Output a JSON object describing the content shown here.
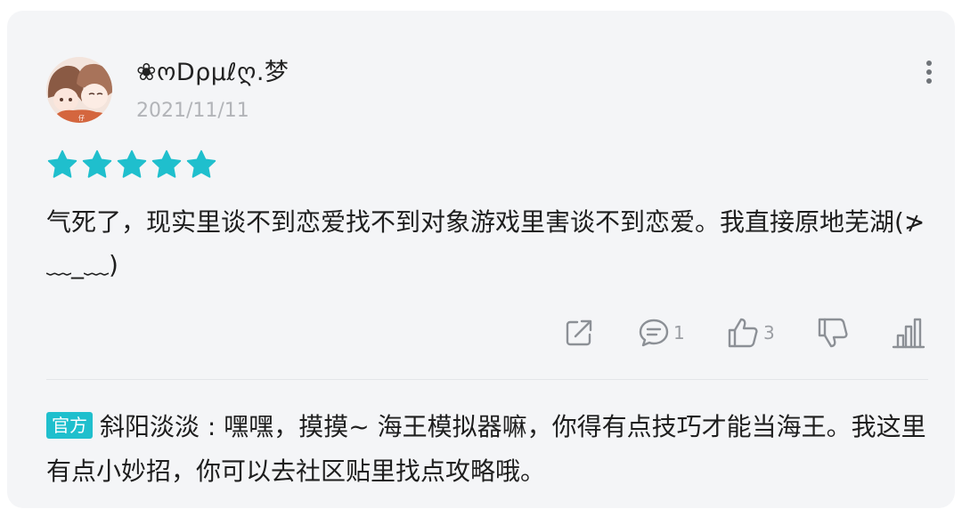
{
  "review": {
    "user": {
      "name": "❀ოDρμℓღ.梦",
      "date": "2021/11/11",
      "avatar": "anime-girls-avatar"
    },
    "rating": {
      "value": 5,
      "max": 5,
      "star_color": "#1fbfcd"
    },
    "content": "气死了，现实里谈不到恋爱找不到对象游戏里害谈不到恋爱。我直接原地芜湖(≯﹏_﹏)",
    "actions": {
      "share_icon": "share-icon",
      "comment_icon": "comment-icon",
      "comment_count": "1",
      "like_icon": "thumbs-up-icon",
      "like_count": "3",
      "dislike_icon": "thumbs-down-icon",
      "stats_icon": "bar-chart-icon"
    },
    "more_icon": "more-vertical-icon"
  },
  "official_reply": {
    "badge": "官方",
    "author": "斜阳淡淡",
    "separator": " : ",
    "text": "嘿嘿，摸摸~ 海王模拟器嘛，你得有点技巧才能当海王。我这里有点小妙招，你可以去社区贴里找点攻略哦。"
  },
  "colors": {
    "card_bg": "#f4f5f7",
    "accent": "#1fbfcd",
    "icon_gray": "#8c9096"
  }
}
